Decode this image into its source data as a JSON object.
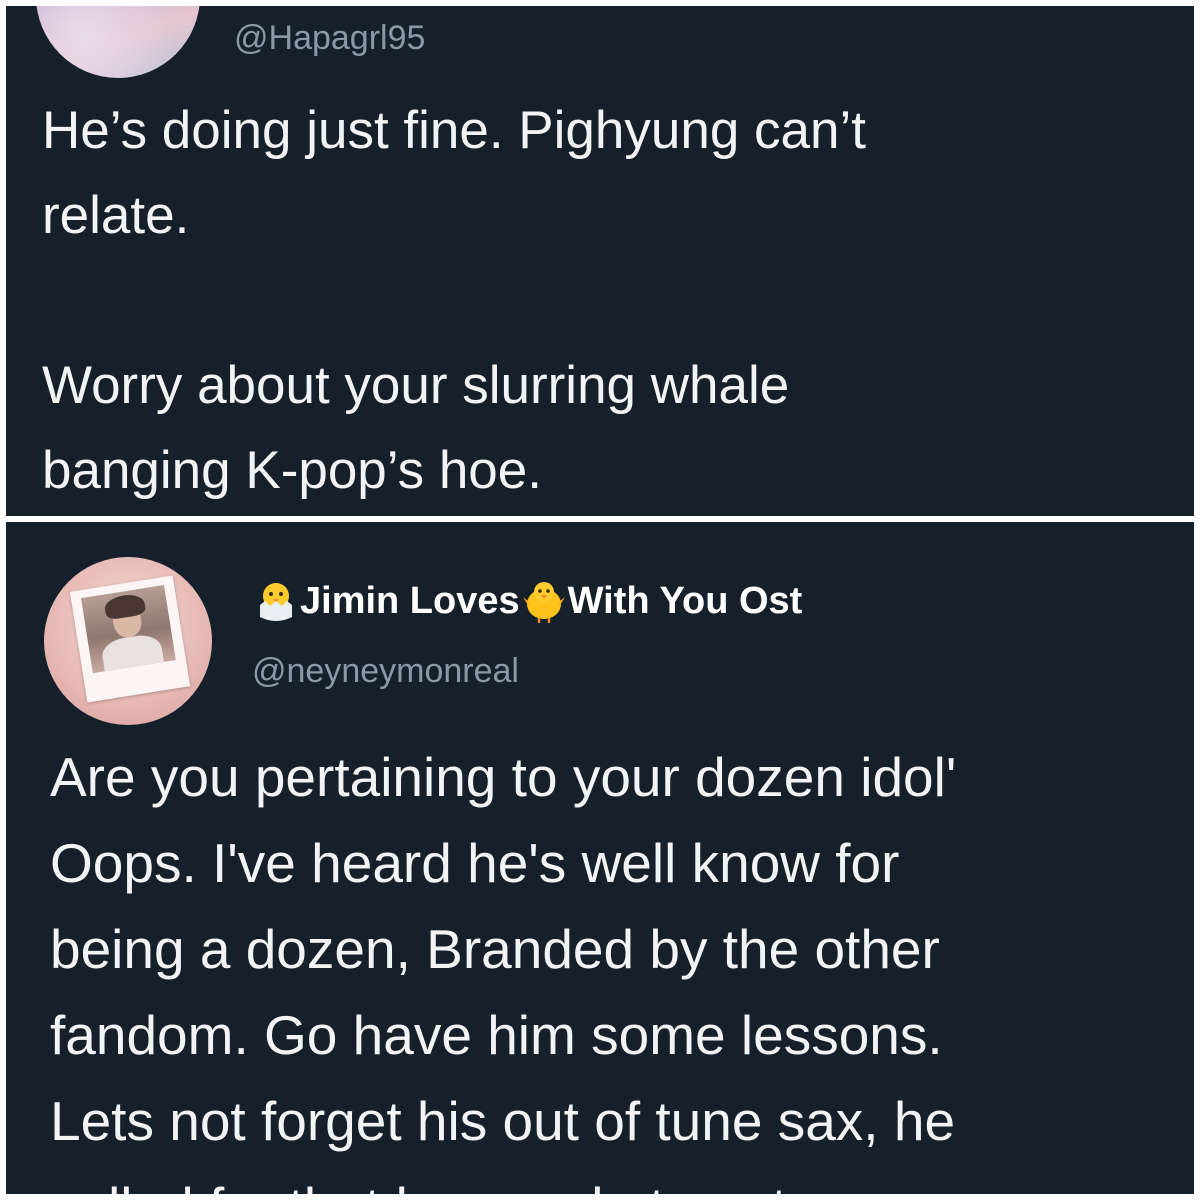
{
  "tweet_top": {
    "handle": "@Hapagrl95",
    "lines": [
      "He’s doing just fine.  Pighyung can’t",
      "relate.",
      "Worry about your slurring whale",
      "banging K-pop’s hoe."
    ]
  },
  "tweet_bottom": {
    "display_name_part1": "Jimin Loves",
    "display_name_part2": "With You Ost",
    "emoji_1": "hatching-chick-icon",
    "emoji_2": "chick-icon",
    "handle": "@neyneymonreal",
    "lines": [
      "Are you pertaining to your dozen idol'",
      "Oops. I've heard he's well know for",
      "being a dozen, Branded by the other",
      "fandom. Go have him some lessons.",
      "Lets not forget his out of tune sax, he",
      "yelled for that huge sale to get"
    ]
  },
  "colors": {
    "background": "#15202b",
    "text": "#f1f3f4",
    "handle": "#8b98a5",
    "divider": "#ffffff"
  }
}
